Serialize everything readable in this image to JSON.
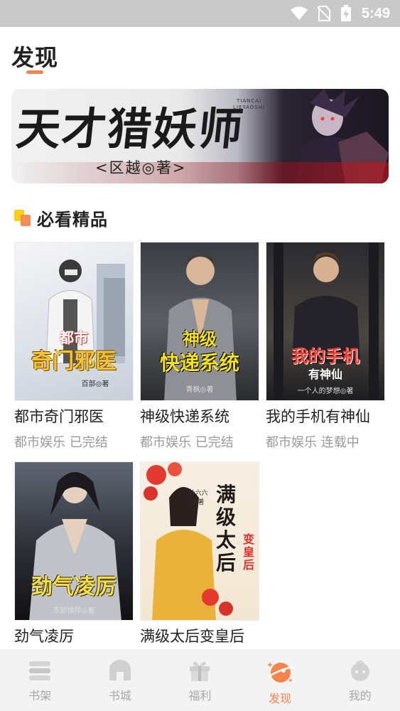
{
  "status_bar": {
    "time": "5:49"
  },
  "header": {
    "title": "发现"
  },
  "banner": {
    "title": "天才猎妖师",
    "author": "<区越◎著>",
    "pinyin_top": "TIANCAI",
    "pinyin_bottom": "LIEYAOSHI"
  },
  "section": {
    "title": "必看精品"
  },
  "books": [
    {
      "title": "都市奇门邪医",
      "meta": "都市娱乐 已完结",
      "cover_line1": "都市",
      "cover_line2": "奇门邪医",
      "cover_author": "百部◎著"
    },
    {
      "title": "神级快递系统",
      "meta": "都市娱乐 已完结",
      "cover_line1": "神级",
      "cover_line2": "快递系统",
      "cover_author": "青枫◎著"
    },
    {
      "title": "我的手机有神仙",
      "meta": "都市娱乐 连载中",
      "cover_line1": "我的手机",
      "cover_line2": "有神仙",
      "cover_author": "一个人的梦想◎著"
    },
    {
      "title": "劲气凌厉",
      "meta": "",
      "cover_line1": "劲气凌厉",
      "cover_line2": "",
      "cover_author": "李郎憔悴◎著"
    },
    {
      "title": "满级太后变皇后",
      "meta": "",
      "cover_line1": "满级太后",
      "cover_line2": "变皇后",
      "cover_author": "孙六六◎著"
    }
  ],
  "tabs": [
    {
      "label": "书架",
      "icon": "bookshelf-icon"
    },
    {
      "label": "书城",
      "icon": "bookstore-icon"
    },
    {
      "label": "福利",
      "icon": "gift-icon"
    },
    {
      "label": "发现",
      "icon": "planet-icon",
      "active": true
    },
    {
      "label": "我的",
      "icon": "profile-icon"
    }
  ],
  "colors": {
    "accent": "#f5854f",
    "inactive": "#a9a9a9",
    "status_bar": "#c9c9c9"
  }
}
